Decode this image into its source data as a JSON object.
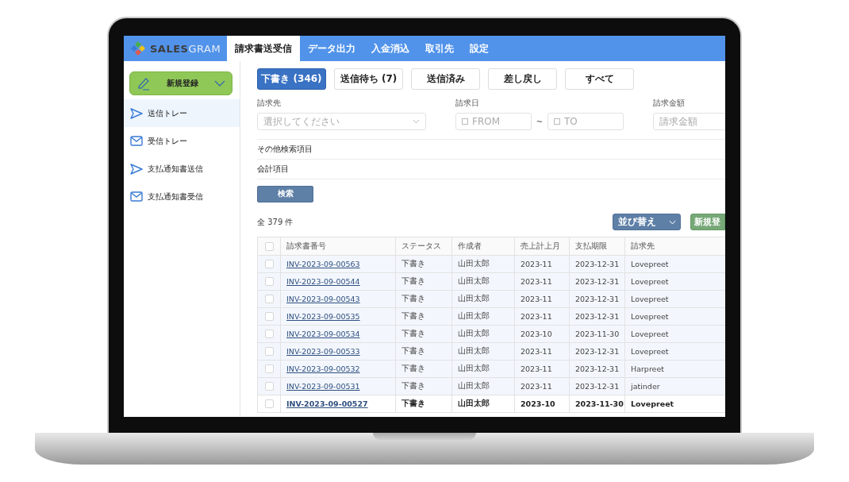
{
  "header": {
    "logo": "**SALES**GRAM",
    "tabs": [
      {
        "label": "請求書送受信",
        "selected": true
      },
      {
        "label": "データ出力",
        "selected": false
      },
      {
        "label": "入金消込",
        "selected": false
      },
      {
        "label": "取引先",
        "selected": false
      },
      {
        "label": "設定",
        "selected": false
      }
    ]
  },
  "sidebar": {
    "new_button": "新規登録",
    "items": [
      {
        "label": "送信トレー",
        "kind": "send",
        "selected": true
      },
      {
        "label": "受信トレー",
        "kind": "mail",
        "selected": false
      },
      {
        "label": "支払通知書送信",
        "kind": "send",
        "selected": false
      },
      {
        "label": "支払通知書受信",
        "kind": "mail",
        "selected": false
      }
    ]
  },
  "status_filters": [
    {
      "label": "下書き (346)",
      "selected": true
    },
    {
      "label": "送信待ち (7)",
      "selected": false
    },
    {
      "label": "送信済み",
      "selected": false
    },
    {
      "label": "差し戻し",
      "selected": false
    },
    {
      "label": "すべて",
      "selected": false
    }
  ],
  "filters": {
    "client": {
      "label": "請求先",
      "placeholder": "選択してください"
    },
    "date": {
      "label": "請求日",
      "from_placeholder": "FROM",
      "separator": "~",
      "to_placeholder": "TO"
    },
    "amount": {
      "label": "請求金額",
      "placeholder": "請求金額"
    }
  },
  "sections": [
    "その他検索項目",
    "会計項目"
  ],
  "search_button": "検索",
  "total": "全 379 件",
  "sort_button": "並び替え",
  "new_button": "新規登",
  "table": {
    "select_all_checked": false,
    "columns": [
      "請求書番号",
      "ステータス",
      "作成者",
      "売上計上月",
      "支払期限",
      "請求先"
    ],
    "rows": [
      {
        "checked": false,
        "unread": false,
        "cells": [
          "INV-2023-09-00563",
          "下書き",
          "山田太郎",
          "2023-11",
          "2023-12-31",
          "Lovepreet"
        ]
      },
      {
        "checked": false,
        "unread": false,
        "cells": [
          "INV-2023-09-00544",
          "下書き",
          "山田太郎",
          "2023-11",
          "2023-12-31",
          "Lovepreet"
        ]
      },
      {
        "checked": false,
        "unread": false,
        "cells": [
          "INV-2023-09-00543",
          "下書き",
          "山田太郎",
          "2023-11",
          "2023-12-31",
          "Lovepreet"
        ]
      },
      {
        "checked": false,
        "unread": false,
        "cells": [
          "INV-2023-09-00535",
          "下書き",
          "山田太郎",
          "2023-11",
          "2023-12-31",
          "Lovepreet"
        ]
      },
      {
        "checked": false,
        "unread": false,
        "cells": [
          "INV-2023-09-00534",
          "下書き",
          "山田太郎",
          "2023-10",
          "2023-11-30",
          "Lovepreet"
        ]
      },
      {
        "checked": false,
        "unread": false,
        "cells": [
          "INV-2023-09-00533",
          "下書き",
          "山田太郎",
          "2023-11",
          "2023-12-31",
          "Lovepreet"
        ]
      },
      {
        "checked": false,
        "unread": false,
        "cells": [
          "INV-2023-09-00532",
          "下書き",
          "山田太郎",
          "2023-11",
          "2023-12-31",
          "Harpreet"
        ]
      },
      {
        "checked": false,
        "unread": false,
        "cells": [
          "INV-2023-09-00531",
          "下書き",
          "山田太郎",
          "2023-11",
          "2023-12-31",
          "jatinder"
        ]
      },
      {
        "checked": false,
        "unread": true,
        "cells": [
          "INV-2023-09-00527",
          "下書き",
          "山田太郎",
          "2023-10",
          "2023-11-30",
          "Lovepreet"
        ]
      }
    ]
  }
}
